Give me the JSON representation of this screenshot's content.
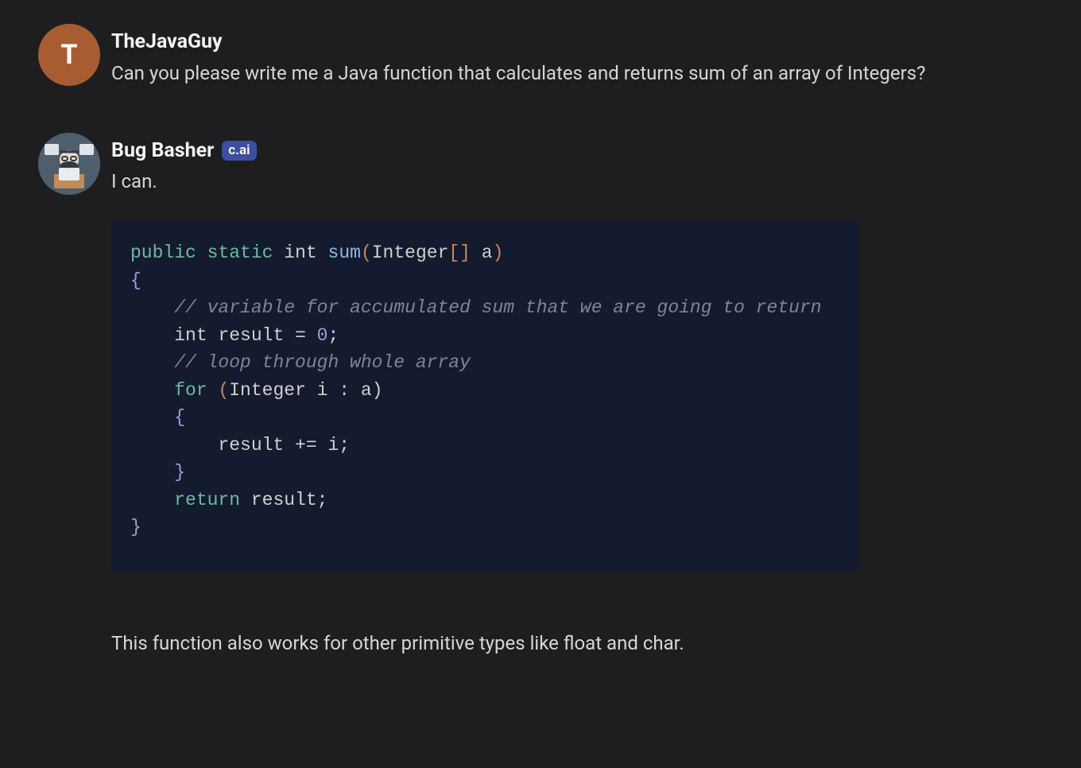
{
  "messages": [
    {
      "author": "TheJavaGuy",
      "avatar_letter": "T",
      "avatar_kind": "letter",
      "badge": null,
      "text": "Can you please write me a Java function that calculates and returns sum of an array of Integers?"
    },
    {
      "author": "Bug Basher",
      "avatar_letter": "",
      "avatar_kind": "bot",
      "badge": "c.ai",
      "text": "I can.",
      "code": {
        "line1_public": "public",
        "line1_static": "static",
        "line1_int": "int",
        "line1_fn": "sum",
        "line1_open_paren": "(",
        "line1_param_type": "Integer",
        "line1_brackets": "[]",
        "line1_param_name": "a",
        "line1_close_paren": ")",
        "line2_brace": "{",
        "line3_comment": "// variable for accumulated sum that we are going to return",
        "line4_int": "int",
        "line4_decl": " result ",
        "line4_eq": "=",
        "line4_zero": " 0",
        "line4_semi": ";",
        "line5_comment": "// loop through whole array",
        "line6_for": "for",
        "line6_open": " (",
        "line6_integer": "Integer",
        "line6_rest": " i : a)",
        "line7_brace": "    {",
        "line8_body": "        result ",
        "line8_op": "+=",
        "line8_body2": " i;",
        "line9_brace": "    }",
        "line10_return": "return",
        "line10_rest": " result;",
        "line11_brace": "}"
      },
      "follow_text": "This function also works for other primitive types like float and char."
    }
  ]
}
